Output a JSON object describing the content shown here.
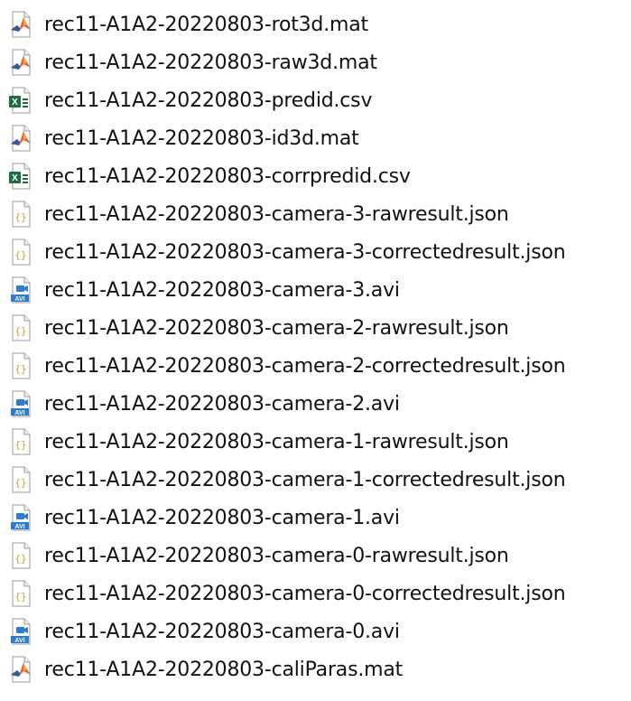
{
  "files": [
    {
      "name": "rec11-A1A2-20220803-rot3d.mat",
      "icon": "matlab-file-icon"
    },
    {
      "name": "rec11-A1A2-20220803-raw3d.mat",
      "icon": "matlab-file-icon"
    },
    {
      "name": "rec11-A1A2-20220803-predid.csv",
      "icon": "excel-csv-file-icon"
    },
    {
      "name": "rec11-A1A2-20220803-id3d.mat",
      "icon": "matlab-file-icon"
    },
    {
      "name": "rec11-A1A2-20220803-corrpredid.csv",
      "icon": "excel-csv-file-icon"
    },
    {
      "name": "rec11-A1A2-20220803-camera-3-rawresult.json",
      "icon": "json-file-icon"
    },
    {
      "name": "rec11-A1A2-20220803-camera-3-correctedresult.json",
      "icon": "json-file-icon"
    },
    {
      "name": "rec11-A1A2-20220803-camera-3.avi",
      "icon": "avi-video-file-icon"
    },
    {
      "name": "rec11-A1A2-20220803-camera-2-rawresult.json",
      "icon": "json-file-icon"
    },
    {
      "name": "rec11-A1A2-20220803-camera-2-correctedresult.json",
      "icon": "json-file-icon"
    },
    {
      "name": "rec11-A1A2-20220803-camera-2.avi",
      "icon": "avi-video-file-icon"
    },
    {
      "name": "rec11-A1A2-20220803-camera-1-rawresult.json",
      "icon": "json-file-icon"
    },
    {
      "name": "rec11-A1A2-20220803-camera-1-correctedresult.json",
      "icon": "json-file-icon"
    },
    {
      "name": "rec11-A1A2-20220803-camera-1.avi",
      "icon": "avi-video-file-icon"
    },
    {
      "name": "rec11-A1A2-20220803-camera-0-rawresult.json",
      "icon": "json-file-icon"
    },
    {
      "name": "rec11-A1A2-20220803-camera-0-correctedresult.json",
      "icon": "json-file-icon"
    },
    {
      "name": "rec11-A1A2-20220803-camera-0.avi",
      "icon": "avi-video-file-icon"
    },
    {
      "name": "rec11-A1A2-20220803-caliParas.mat",
      "icon": "matlab-file-icon"
    }
  ],
  "icon_labels": {
    "avi": "AVI",
    "excel": "X",
    "json": "{}"
  },
  "colors": {
    "excel_green": "#1d6f42",
    "avi_blue": "#2b7cd3",
    "matlab_orange": "#e16737",
    "json_gold": "#c9a227"
  }
}
